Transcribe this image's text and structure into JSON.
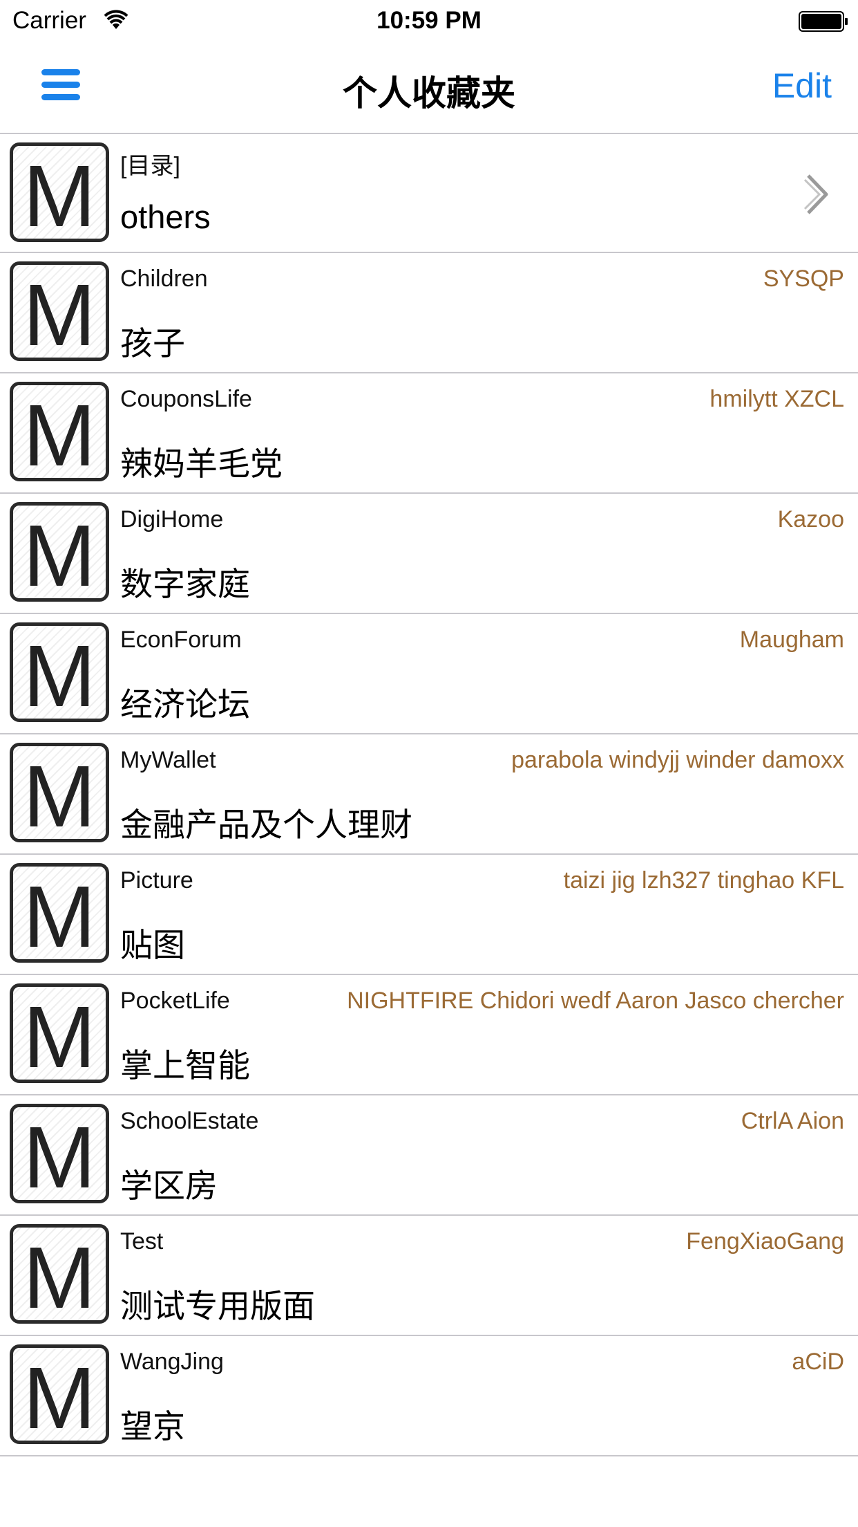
{
  "status_bar": {
    "carrier": "Carrier",
    "time": "10:59 PM"
  },
  "nav": {
    "title": "个人收藏夹",
    "edit_label": "Edit"
  },
  "icons": {
    "menu": "hamburger-menu-icon",
    "wifi": "wifi-icon",
    "battery": "battery-icon",
    "chevron": "chevron-right-icon",
    "board_badge": "M"
  },
  "colors": {
    "accent": "#1a82ea",
    "moderators": "#9b6a34",
    "separator": "#c8c7cc"
  },
  "directory": {
    "tag": "[目录]",
    "name": "others"
  },
  "boards": [
    {
      "en": "Children",
      "cn": "孩子",
      "mods": "SYSQP"
    },
    {
      "en": "CouponsLife",
      "cn": "辣妈羊毛党",
      "mods": "hmilytt XZCL"
    },
    {
      "en": "DigiHome",
      "cn": "数字家庭",
      "mods": "Kazoo"
    },
    {
      "en": "EconForum",
      "cn": "经济论坛",
      "mods": "Maugham"
    },
    {
      "en": "MyWallet",
      "cn": "金融产品及个人理财",
      "mods": "parabola windyjj winder damoxx"
    },
    {
      "en": "Picture",
      "cn": "贴图",
      "mods": "taizi jig lzh327 tinghao KFL"
    },
    {
      "en": "PocketLife",
      "cn": "掌上智能",
      "mods": "NIGHTFIRE Chidori wedf Aaron Jasco chercher"
    },
    {
      "en": "SchoolEstate",
      "cn": "学区房",
      "mods": "CtrlA Aion"
    },
    {
      "en": "Test",
      "cn": "测试专用版面",
      "mods": "FengXiaoGang"
    },
    {
      "en": "WangJing",
      "cn": "望京",
      "mods": "aCiD"
    }
  ]
}
